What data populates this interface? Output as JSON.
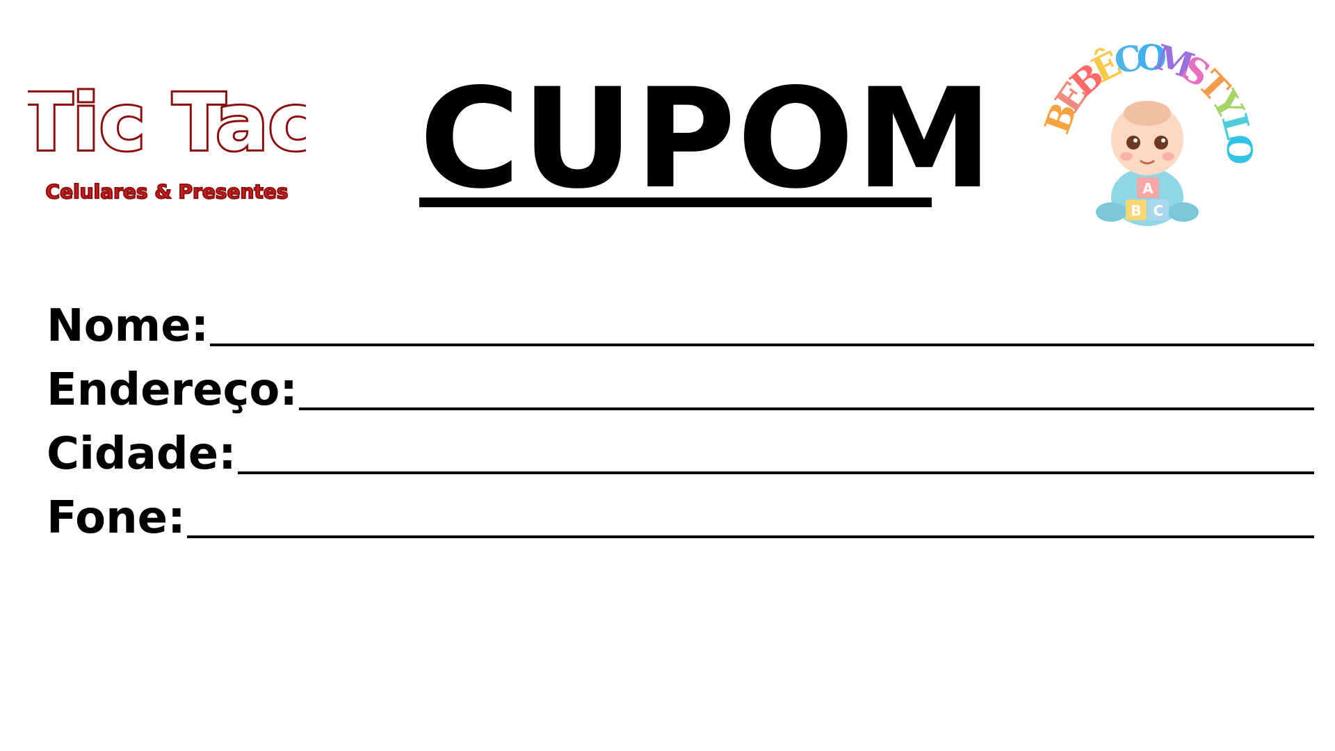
{
  "logo_left": {
    "name": "Tic Tac",
    "subtitle": "Celulares & Presentes",
    "colors": {
      "outline": "#8b0d0d",
      "fill": "#ffffff",
      "subtitle_fill": "#c81e1e"
    }
  },
  "title": "CUPOM",
  "logo_right": {
    "text_letters": [
      "B",
      "E",
      "B",
      "Ê",
      "C",
      "O",
      "M",
      "S",
      "T",
      "Y",
      "L",
      "O"
    ],
    "block_letters": [
      "A",
      "B",
      "C"
    ],
    "colors": [
      "#f4a340",
      "#f08a7e",
      "#ff6b6b",
      "#f7c948",
      "#4fb3e8",
      "#3fb0f0",
      "#9b6fe0",
      "#e86fbf",
      "#f59a4a",
      "#a6d468",
      "#4ccdd9",
      "#30c3e3"
    ]
  },
  "form": {
    "fields": [
      {
        "label": "Nome:"
      },
      {
        "label": "Endereço:"
      },
      {
        "label": "Cidade:"
      },
      {
        "label": "Fone:"
      }
    ]
  }
}
